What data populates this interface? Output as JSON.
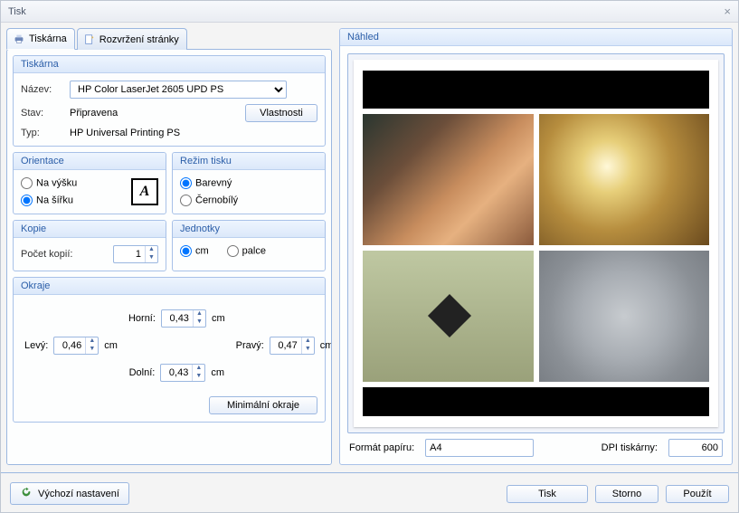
{
  "window": {
    "title": "Tisk"
  },
  "tabs": {
    "printer": {
      "label": "Tiskárna"
    },
    "layout": {
      "label": "Rozvržení stránky"
    }
  },
  "printer_group": {
    "title": "Tiskárna",
    "name_label": "Název:",
    "name_value": "HP Color LaserJet 2605 UPD PS",
    "status_label": "Stav:",
    "status_value": "Připravena",
    "props_button": "Vlastnosti",
    "type_label": "Typ:",
    "type_value": "HP Universal Printing PS"
  },
  "orientation": {
    "title": "Orientace",
    "portrait": "Na výšku",
    "landscape": "Na šířku",
    "selected": "landscape"
  },
  "mode": {
    "title": "Režim tisku",
    "color": "Barevný",
    "bw": "Černobílý",
    "selected": "color"
  },
  "copies": {
    "title": "Kopie",
    "label": "Počet kopií:",
    "value": "1"
  },
  "units": {
    "title": "Jednotky",
    "cm": "cm",
    "inch": "palce",
    "selected": "cm"
  },
  "margins": {
    "title": "Okraje",
    "top_label": "Horní:",
    "left_label": "Levý:",
    "right_label": "Pravý:",
    "bottom_label": "Dolní:",
    "unit": "cm",
    "top": "0,43",
    "left": "0,46",
    "right": "0,47",
    "bottom": "0,43",
    "min_button": "Minimální okraje"
  },
  "preview": {
    "title": "Náhled",
    "paper_label": "Formát papíru:",
    "paper_value": "A4",
    "dpi_label": "DPI tiskárny:",
    "dpi_value": "600"
  },
  "buttons": {
    "defaults": "Výchozí nastavení",
    "print": "Tisk",
    "cancel": "Storno",
    "apply": "Použít"
  }
}
